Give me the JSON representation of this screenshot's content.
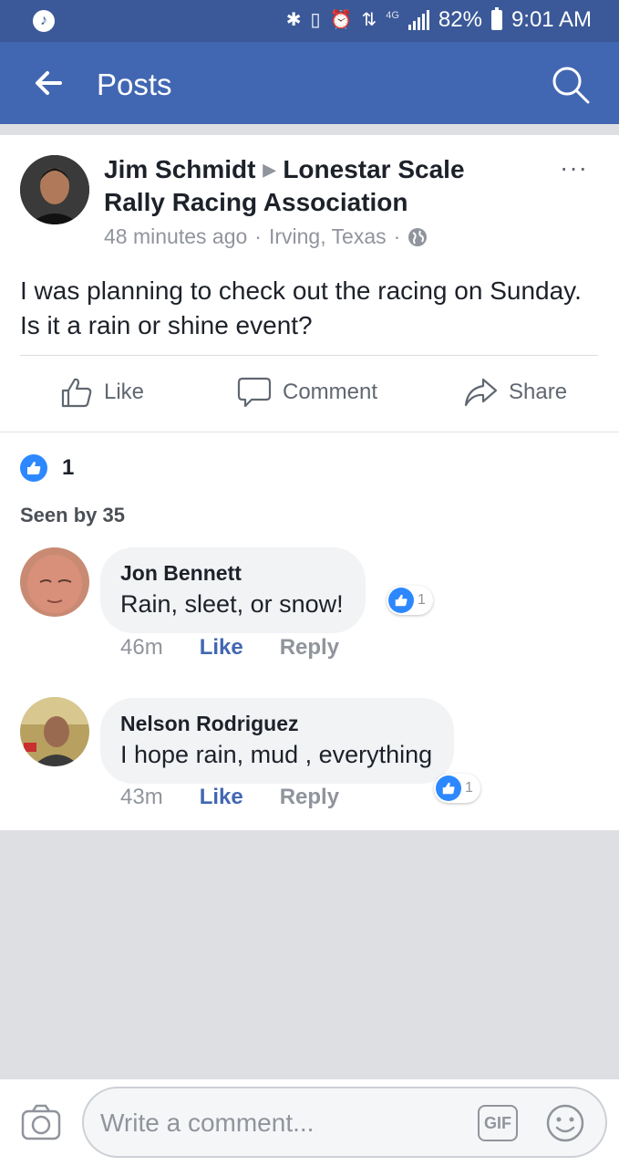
{
  "status_bar": {
    "network": "4G",
    "battery": "82%",
    "time": "9:01 AM"
  },
  "app_bar": {
    "title": "Posts",
    "icons": [
      "back-arrow-icon",
      "search-icon"
    ]
  },
  "post": {
    "author": "Jim Schmidt",
    "group": "Lonestar Scale Rally Racing Association",
    "time": "48 minutes ago",
    "location": "Irving, Texas",
    "privacy_icon": "globe-icon",
    "text": "I was planning to check out the racing on Sunday. Is it a rain or shine event?",
    "actions": {
      "like": "Like",
      "comment": "Comment",
      "share": "Share"
    },
    "reaction_count": "1",
    "seen_by": "Seen by 35"
  },
  "comments": [
    {
      "name": "Jon Bennett",
      "text": "Rain, sleet, or snow!",
      "time": "46m",
      "like_label": "Like",
      "reply_label": "Reply",
      "like_count": "1"
    },
    {
      "name": "Nelson Rodriguez",
      "text": "I hope rain, mud , everything",
      "time": "43m",
      "like_label": "Like",
      "reply_label": "Reply",
      "like_count": "1"
    }
  ],
  "composer": {
    "placeholder": "Write a comment...",
    "gif_label": "GIF"
  },
  "colors": {
    "brand": "#4267b2",
    "status_bar": "#3b5998",
    "like_blue": "#2d88ff"
  }
}
